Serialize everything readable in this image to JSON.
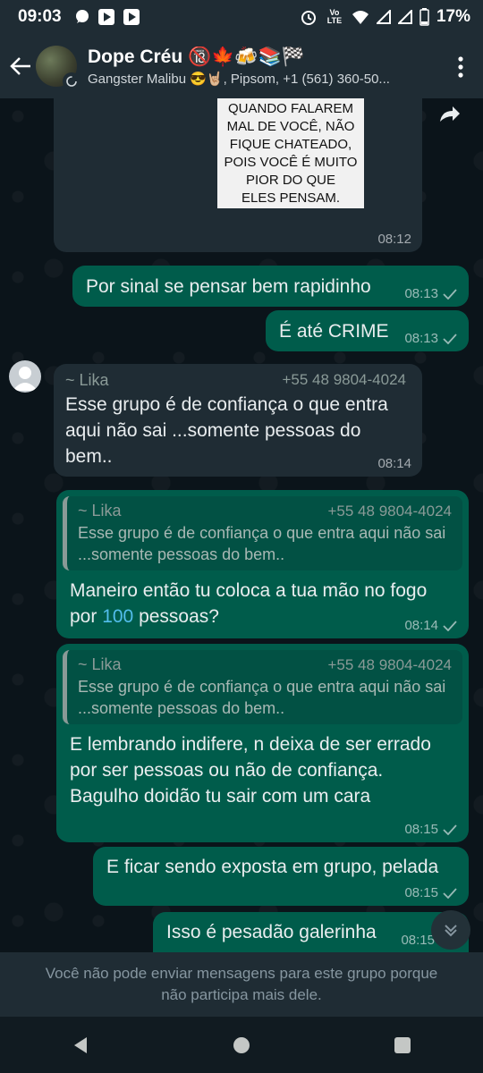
{
  "status_bar": {
    "time": "09:03",
    "battery": "17%",
    "network": "Vo LTE"
  },
  "header": {
    "title": "Dope Créu 🔞🍁🍻📚🏁",
    "subtitle": "Gangster Malibu 😎🤘🏼, Pipsom, +1 (561) 360-50..."
  },
  "image_card": {
    "lines": [
      "QUANDO FALAREM",
      "MAL DE VOCÊ, NÃO",
      "FIQUE CHATEADO,",
      "POIS VOCÊ É MUITO",
      "PIOR DO QUE",
      "ELES PENSAM."
    ],
    "time": "08:12"
  },
  "messages": {
    "m1": {
      "text": "Por sinal se pensar bem rapidinho",
      "time": "08:13"
    },
    "m2": {
      "text": "É até CRIME",
      "time": "08:13"
    },
    "m3": {
      "sender": "~ Lika",
      "phone": "+55 48 9804-4024",
      "text": "Esse grupo é de confiança o que entra aqui não sai ...somente pessoas do bem..",
      "time": "08:14"
    },
    "m4": {
      "quote_author": "~ Lika",
      "quote_phone": "+55 48 9804-4024",
      "quote_text": "Esse grupo é de confiança o que entra aqui não sai ...somente pessoas do bem..",
      "text_a": "Maneiro então tu coloca a tua mão no fogo por ",
      "text_num": "100",
      "text_b": " pessoas?",
      "time": "08:14"
    },
    "m5": {
      "quote_author": "~ Lika",
      "quote_phone": "+55 48 9804-4024",
      "quote_text": "Esse grupo é de confiança o que entra aqui não sai ...somente pessoas do bem..",
      "text": "E lembrando indifere, n deixa de ser errado por ser pessoas ou não de confiança. Bagulho doidão tu sair com um cara",
      "time": "08:15"
    },
    "m6": {
      "text": "E ficar sendo exposta em grupo, pelada",
      "time": "08:15"
    },
    "m7": {
      "text": "Isso é pesadão galerinha",
      "time": "08:15"
    }
  },
  "footer": {
    "notice": "Você não pode enviar mensagens para este grupo porque não participa mais dele."
  },
  "colors": {
    "incoming": "#1f2c34",
    "outgoing": "#005c4b",
    "background": "#0b141a",
    "link": "#53bdeb"
  }
}
